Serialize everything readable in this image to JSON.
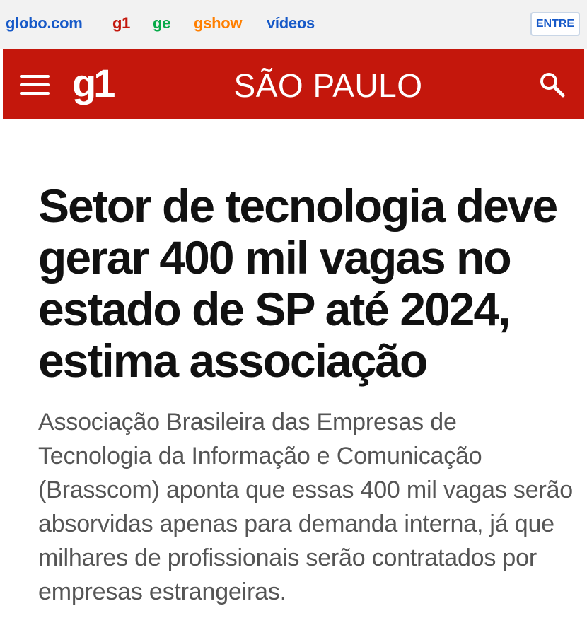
{
  "topbar": {
    "links": {
      "globo": "globo.com",
      "g1": "g1",
      "ge": "ge",
      "gshow": "gshow",
      "videos": "vídeos"
    },
    "login_label": "ENTRE"
  },
  "header": {
    "logo": "g1",
    "section_title": "SÃO PAULO",
    "menu_icon": "hamburger-menu-icon",
    "search_icon": "search-icon"
  },
  "article": {
    "headline": "Setor de tecnologia deve gerar 400 mil vagas no estado de SP até 2024, estima associação",
    "subheadline": "Associação Brasileira das Empresas de Tecnologia da Informação e Comunicação (Brasscom) aponta que essas 400 mil vagas serão absorvidas apenas para demanda interna, já que milhares de profissionais serão contratados por empresas estrangeiras."
  },
  "colors": {
    "brand_red": "#c4170c",
    "globo_blue": "#1659c8",
    "ge_green": "#06aa48",
    "gshow_orange": "#ff7f00",
    "headline_text": "#111111",
    "subheadline_text": "#555555"
  }
}
